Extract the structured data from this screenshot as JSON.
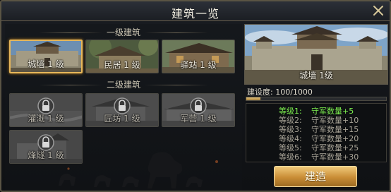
{
  "window": {
    "title": "建筑一览"
  },
  "sections": {
    "tier1_title": "一级建筑",
    "tier2_title": "二级建筑"
  },
  "tier1": [
    {
      "label": "城墙 1 级",
      "selected": true
    },
    {
      "label": "民居 1 级"
    },
    {
      "label": "驿站 1 级"
    }
  ],
  "tier2": [
    {
      "label": "灌溉 1 级",
      "locked": true
    },
    {
      "label": "匠坊 1 级",
      "locked": true
    },
    {
      "label": "军营 1 级",
      "locked": true
    },
    {
      "label": "烽燧 1 级",
      "locked": true
    }
  ],
  "detail": {
    "name": "城墙 1级",
    "progress_label": "建设度: 100/1000",
    "progress_value": 100,
    "progress_max": 1000,
    "levels": [
      {
        "level": "等级1:",
        "effect": "守军数量+5",
        "current": true
      },
      {
        "level": "等级2:",
        "effect": "守军数量+10"
      },
      {
        "level": "等级3:",
        "effect": "守军数量+15"
      },
      {
        "level": "等级4:",
        "effect": "守军数量+20"
      },
      {
        "level": "等级5:",
        "effect": "守军数量+25"
      },
      {
        "level": "等级6:",
        "effect": "守军数量+30"
      }
    ],
    "build_button": "建造"
  },
  "colors": {
    "accent_gold": "#e7b75a",
    "current_level_green": "#7df04f"
  }
}
